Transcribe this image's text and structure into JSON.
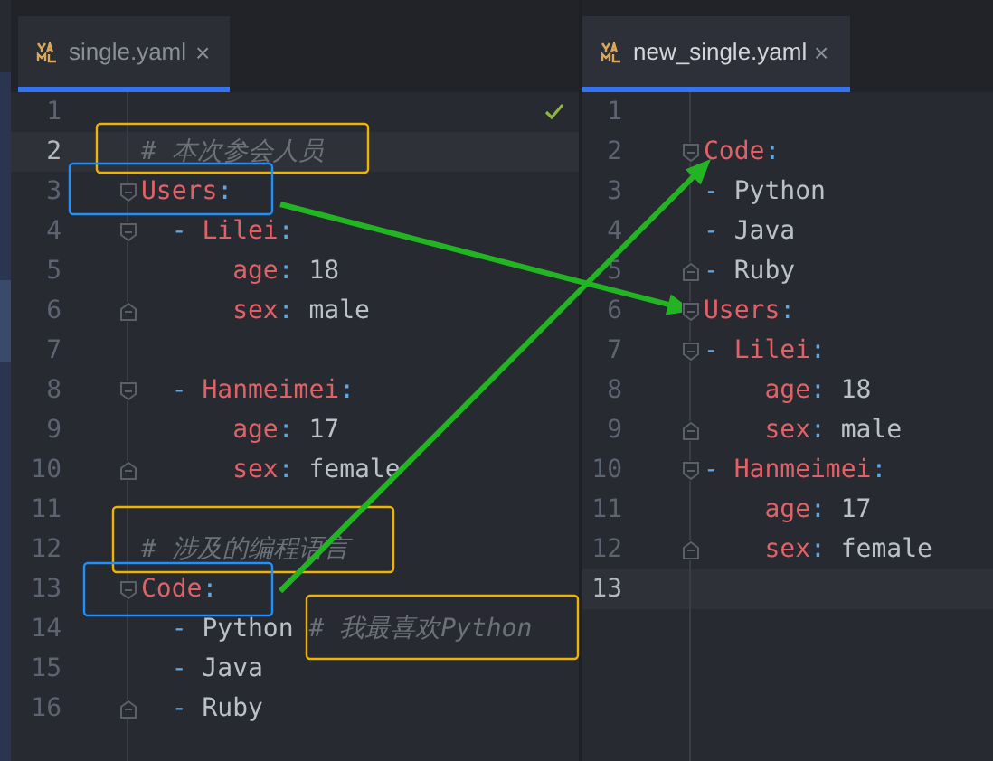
{
  "panes": [
    {
      "active": false,
      "tab": {
        "label": "single.yaml",
        "selected": true,
        "close": "×"
      },
      "status_check": true,
      "lines": [
        {
          "number": "1",
          "current": false
        },
        {
          "number": "2",
          "current": true,
          "tokens": [
            {
              "kind": "comment",
              "text": "# 本次参会人员"
            }
          ]
        },
        {
          "number": "3",
          "current": false,
          "fold_start": true,
          "tokens": [
            {
              "kind": "key",
              "text": "Users"
            },
            {
              "kind": "punct",
              "text": ":"
            }
          ]
        },
        {
          "number": "4",
          "current": false,
          "fold_start": true,
          "tokens": [
            {
              "kind": "punct",
              "text": "  - "
            },
            {
              "kind": "key",
              "text": "Lilei"
            },
            {
              "kind": "punct",
              "text": ":"
            }
          ]
        },
        {
          "number": "5",
          "current": false,
          "tokens": [
            {
              "kind": "key",
              "text": "      age"
            },
            {
              "kind": "punct",
              "text": ": "
            },
            {
              "kind": "scalar",
              "text": "18"
            }
          ]
        },
        {
          "number": "6",
          "current": false,
          "fold_end": true,
          "tokens": [
            {
              "kind": "key",
              "text": "      sex"
            },
            {
              "kind": "punct",
              "text": ": "
            },
            {
              "kind": "scalar",
              "text": "male"
            }
          ]
        },
        {
          "number": "7",
          "current": false
        },
        {
          "number": "8",
          "current": false,
          "fold_start": true,
          "tokens": [
            {
              "kind": "punct",
              "text": "  - "
            },
            {
              "kind": "key",
              "text": "Hanmeimei"
            },
            {
              "kind": "punct",
              "text": ":"
            }
          ]
        },
        {
          "number": "9",
          "current": false,
          "tokens": [
            {
              "kind": "key",
              "text": "      age"
            },
            {
              "kind": "punct",
              "text": ": "
            },
            {
              "kind": "scalar",
              "text": "17"
            }
          ]
        },
        {
          "number": "10",
          "current": false,
          "fold_end": true,
          "tokens": [
            {
              "kind": "key",
              "text": "      sex"
            },
            {
              "kind": "punct",
              "text": ": "
            },
            {
              "kind": "scalar",
              "text": "female"
            }
          ]
        },
        {
          "number": "11",
          "current": false
        },
        {
          "number": "12",
          "current": false,
          "tokens": [
            {
              "kind": "comment",
              "text": "# 涉及的编程语言"
            }
          ]
        },
        {
          "number": "13",
          "current": false,
          "fold_start": true,
          "tokens": [
            {
              "kind": "key",
              "text": "Code"
            },
            {
              "kind": "punct",
              "text": ":"
            }
          ]
        },
        {
          "number": "14",
          "current": false,
          "tokens": [
            {
              "kind": "punct",
              "text": "  - "
            },
            {
              "kind": "scalar",
              "text": "Python "
            },
            {
              "kind": "comment",
              "text": "# 我最喜欢Python"
            }
          ]
        },
        {
          "number": "15",
          "current": false,
          "tokens": [
            {
              "kind": "punct",
              "text": "  - "
            },
            {
              "kind": "scalar",
              "text": "Java"
            }
          ]
        },
        {
          "number": "16",
          "current": false,
          "fold_end": true,
          "tokens": [
            {
              "kind": "punct",
              "text": "  - "
            },
            {
              "kind": "scalar",
              "text": "Ruby"
            }
          ]
        }
      ]
    },
    {
      "active": true,
      "tab": {
        "label": "new_single.yaml",
        "selected": true,
        "close": "×"
      },
      "status_check": false,
      "lines": [
        {
          "number": "1",
          "current": false
        },
        {
          "number": "2",
          "current": false,
          "fold_start": true,
          "tokens": [
            {
              "kind": "key",
              "text": "Code"
            },
            {
              "kind": "punct",
              "text": ":"
            }
          ]
        },
        {
          "number": "3",
          "current": false,
          "tokens": [
            {
              "kind": "punct",
              "text": "- "
            },
            {
              "kind": "scalar",
              "text": "Python"
            }
          ]
        },
        {
          "number": "4",
          "current": false,
          "tokens": [
            {
              "kind": "punct",
              "text": "- "
            },
            {
              "kind": "scalar",
              "text": "Java"
            }
          ]
        },
        {
          "number": "5",
          "current": false,
          "fold_end": true,
          "tokens": [
            {
              "kind": "punct",
              "text": "- "
            },
            {
              "kind": "scalar",
              "text": "Ruby"
            }
          ]
        },
        {
          "number": "6",
          "current": false,
          "fold_start": true,
          "tokens": [
            {
              "kind": "key",
              "text": "Users"
            },
            {
              "kind": "punct",
              "text": ":"
            }
          ]
        },
        {
          "number": "7",
          "current": false,
          "fold_start": true,
          "tokens": [
            {
              "kind": "punct",
              "text": "- "
            },
            {
              "kind": "key",
              "text": "Lilei"
            },
            {
              "kind": "punct",
              "text": ":"
            }
          ]
        },
        {
          "number": "8",
          "current": false,
          "tokens": [
            {
              "kind": "key",
              "text": "    age"
            },
            {
              "kind": "punct",
              "text": ": "
            },
            {
              "kind": "scalar",
              "text": "18"
            }
          ]
        },
        {
          "number": "9",
          "current": false,
          "fold_end": true,
          "tokens": [
            {
              "kind": "key",
              "text": "    sex"
            },
            {
              "kind": "punct",
              "text": ": "
            },
            {
              "kind": "scalar",
              "text": "male"
            }
          ]
        },
        {
          "number": "10",
          "current": false,
          "fold_start": true,
          "tokens": [
            {
              "kind": "punct",
              "text": "- "
            },
            {
              "kind": "key",
              "text": "Hanmeimei"
            },
            {
              "kind": "punct",
              "text": ":"
            }
          ]
        },
        {
          "number": "11",
          "current": false,
          "tokens": [
            {
              "kind": "key",
              "text": "    age"
            },
            {
              "kind": "punct",
              "text": ": "
            },
            {
              "kind": "scalar",
              "text": "17"
            }
          ]
        },
        {
          "number": "12",
          "current": false,
          "fold_end": true,
          "tokens": [
            {
              "kind": "key",
              "text": "    sex"
            },
            {
              "kind": "punct",
              "text": ": "
            },
            {
              "kind": "scalar",
              "text": "female"
            }
          ]
        },
        {
          "number": "13",
          "current": true
        }
      ]
    }
  ],
  "annotations": [
    {
      "kind": "box",
      "color": "#f0b400"
    },
    {
      "kind": "box",
      "color": "#1e90ff"
    },
    {
      "kind": "box",
      "color": "#f0b400"
    },
    {
      "kind": "box",
      "color": "#1e90ff"
    },
    {
      "kind": "box",
      "color": "#f0b400"
    },
    {
      "kind": "arrow",
      "color": "#22b422"
    },
    {
      "kind": "arrow",
      "color": "#22b422"
    }
  ]
}
